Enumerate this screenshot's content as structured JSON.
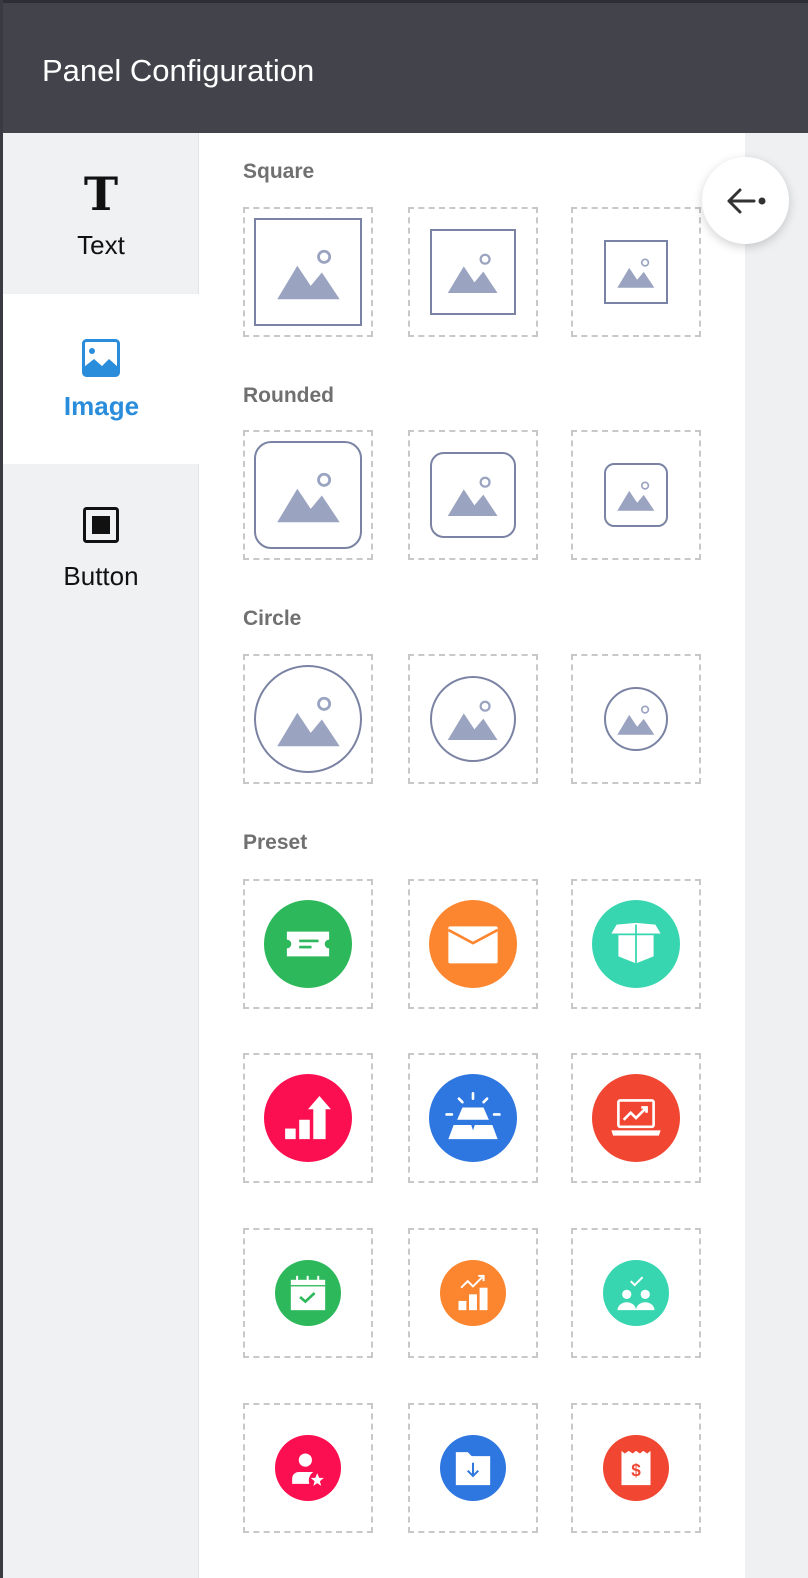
{
  "header": {
    "title": "Panel Configuration"
  },
  "sidebar": {
    "tabs": [
      {
        "label": "Text",
        "icon": "text-icon",
        "active": false
      },
      {
        "label": "Image",
        "icon": "image-icon",
        "active": true
      },
      {
        "label": "Button",
        "icon": "button-icon",
        "active": false
      }
    ]
  },
  "float_button": {
    "icon": "collapse-arrow-icon"
  },
  "sections": {
    "square": {
      "label": "Square"
    },
    "rounded": {
      "label": "Rounded"
    },
    "circle": {
      "label": "Circle"
    },
    "preset": {
      "label": "Preset"
    }
  },
  "shape_sizes": [
    "large",
    "medium",
    "small"
  ],
  "presets": [
    {
      "icon": "ticket-icon",
      "color": "#2eb85c",
      "size": "large"
    },
    {
      "icon": "mail-icon",
      "color": "#fb862f",
      "size": "large"
    },
    {
      "icon": "box-icon",
      "color": "#38d6b0",
      "size": "large"
    },
    {
      "icon": "growth-chart-icon",
      "color": "#fb0f50",
      "size": "large"
    },
    {
      "icon": "gold-bars-icon",
      "color": "#2e76e0",
      "size": "large"
    },
    {
      "icon": "laptop-chart-icon",
      "color": "#f04632",
      "size": "large"
    },
    {
      "icon": "calendar-check-icon",
      "color": "#2eb85c",
      "size": "small"
    },
    {
      "icon": "trend-bars-icon",
      "color": "#fb862f",
      "size": "small"
    },
    {
      "icon": "team-check-icon",
      "color": "#38d6b0",
      "size": "small"
    },
    {
      "icon": "user-star-icon",
      "color": "#fb0f50",
      "size": "small"
    },
    {
      "icon": "folder-download-icon",
      "color": "#2e76e0",
      "size": "small"
    },
    {
      "icon": "receipt-dollar-icon",
      "color": "#f04632",
      "size": "small"
    }
  ]
}
